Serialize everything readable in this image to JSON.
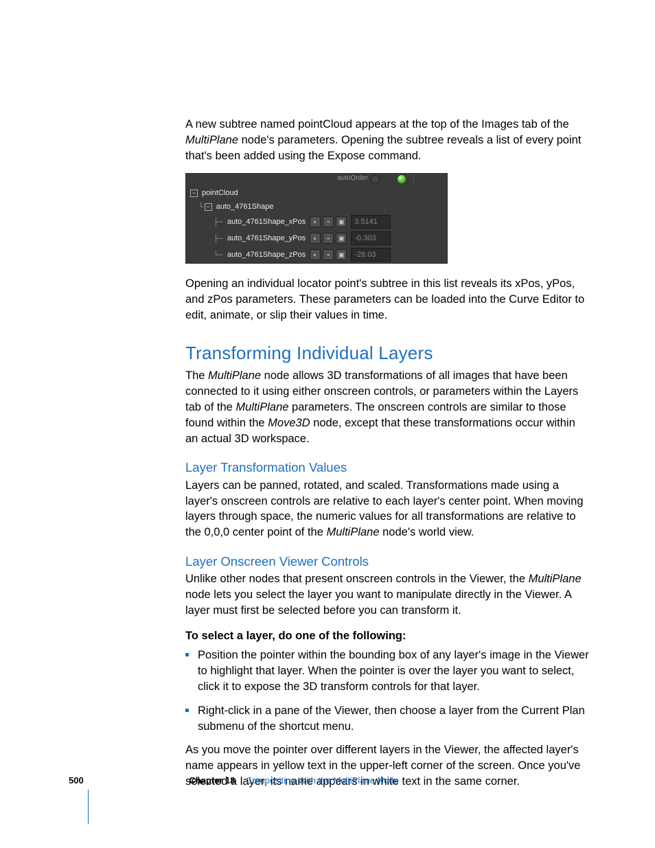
{
  "intro_paragraph_parts": {
    "a": "A new subtree named pointCloud appears at the top of the Images tab of the ",
    "b": "MultiPlane",
    "c": " node's parameters. Opening the subtree reveals a list of every point that's been added using the Expose command."
  },
  "panel": {
    "top_label": "autoOrder",
    "root": "pointCloud",
    "shape": "auto_4761Shape",
    "rows": [
      {
        "label": "auto_4761Shape_xPos",
        "value": "3.5141"
      },
      {
        "label": "auto_4761Shape_yPos",
        "value": "-0.303"
      },
      {
        "label": "auto_4761Shape_zPos",
        "value": "-28.03"
      }
    ]
  },
  "after_panel": "Opening an individual locator point's subtree in this list reveals its xPos, yPos, and zPos parameters. These parameters can be loaded into the Curve Editor to edit, animate, or slip their values in time.",
  "h2": "Transforming Individual Layers",
  "h2_para_parts": {
    "a": "The ",
    "b": "MultiPlane",
    "c": " node allows 3D transformations of all images that have been connected to it using either onscreen controls, or parameters within the Layers tab of the ",
    "d": "MultiPlane",
    "e": " parameters. The onscreen controls are similar to those found within the ",
    "f": "Move3D",
    "g": " node, except that these transformations occur within an actual 3D workspace."
  },
  "h3a": "Layer Transformation Values",
  "h3a_para_parts": {
    "a": "Layers can be panned, rotated, and scaled. Transformations made using a layer's onscreen controls are relative to each layer's center point. When moving layers through space, the numeric values for all transformations are relative to the 0,0,0 center point of the ",
    "b": "MultiPlane",
    "c": " node's world view."
  },
  "h3b": "Layer Onscreen Viewer Controls",
  "h3b_para_parts": {
    "a": "Unlike other nodes that present onscreen controls in the Viewer, the ",
    "b": "MultiPlane",
    "c": " node lets you select the layer you want to manipulate directly in the Viewer. A layer must first be selected before you can transform it."
  },
  "select_heading": "To select a layer, do one of the following:",
  "bullets": [
    "Position the pointer within the bounding box of any layer's image in the Viewer to highlight that layer. When the pointer is over the layer you want to select, click it to expose the 3D transform controls for that layer.",
    "Right-click in a pane of the Viewer, then choose a layer from the Current Plan submenu of the shortcut menu."
  ],
  "closing": "As you move the pointer over different layers in the Viewer, the affected layer's name appears in yellow text in the upper-left corner of the screen. Once you've selected a layer, its name appears in white text in the same corner.",
  "footer": {
    "page": "500",
    "chapter_label": "Chapter 18",
    "chapter_title": "Compositing With the MultiPlane Node"
  }
}
